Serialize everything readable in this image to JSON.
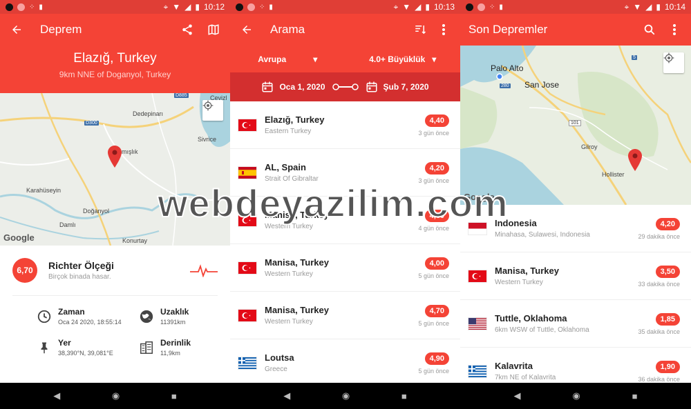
{
  "screen1": {
    "status_time": "10:12",
    "title": "Deprem",
    "location": "Elazığ, Turkey",
    "sublocation": "9km NNE of Doganyol, Turkey",
    "map_labels": [
      "Dedepinarı",
      "Sivrice",
      "mışlık",
      "Karahüseyin",
      "Doğanyol",
      "Damlı",
      "Konurtay",
      "Cevizl"
    ],
    "road_labels": [
      "D885",
      "D300"
    ],
    "google": "Google",
    "magnitude": "6,70",
    "scale_title": "Richter Ölçeği",
    "scale_desc": "Birçok binada hasar.",
    "time_label": "Zaman",
    "time_value": "Oca 24 2020, 18:55:14",
    "distance_label": "Uzaklık",
    "distance_value": "11391km",
    "place_label": "Yer",
    "place_value": "38,390°N, 39,081°E",
    "depth_label": "Derinlik",
    "depth_value": "11,9km"
  },
  "screen2": {
    "status_time": "10:13",
    "title": "Arama",
    "region": "Avrupa",
    "magnitude_filter": "4.0+ Büyüklük",
    "date_from": "Oca 1, 2020",
    "date_to": "Şub 7, 2020",
    "items": [
      {
        "name": "Elazığ, Turkey",
        "region": "Eastern Turkey",
        "mag": "4,40",
        "when": "3 gün önce",
        "flag": "tr"
      },
      {
        "name": "AL, Spain",
        "region": "Strait Of Gibraltar",
        "mag": "4,20",
        "when": "3 gün önce",
        "flag": "es"
      },
      {
        "name": "Manisa, Turkey",
        "region": "Western Turkey",
        "mag": "4,60",
        "when": "4 gün önce",
        "flag": "tr"
      },
      {
        "name": "Manisa, Turkey",
        "region": "Western Turkey",
        "mag": "4,00",
        "when": "5 gün önce",
        "flag": "tr"
      },
      {
        "name": "Manisa, Turkey",
        "region": "Western Turkey",
        "mag": "4,70",
        "when": "5 gün önce",
        "flag": "tr"
      },
      {
        "name": "Loutsa",
        "region": "Greece",
        "mag": "4,90",
        "when": "5 gün önce",
        "flag": "gr"
      }
    ]
  },
  "screen3": {
    "status_time": "10:14",
    "title": "Son Depremler",
    "map_labels": [
      "Palo Alto",
      "San Jose",
      "Gilroy",
      "Hollister"
    ],
    "road_labels": [
      "280",
      "101",
      "5"
    ],
    "google": "Google",
    "items": [
      {
        "name": "Indonesia",
        "region": "Minahasa, Sulawesi, Indonesia",
        "mag": "4,20",
        "when": "29 dakika önce",
        "flag": "id"
      },
      {
        "name": "Manisa, Turkey",
        "region": "Western Turkey",
        "mag": "3,50",
        "when": "33 dakika önce",
        "flag": "tr"
      },
      {
        "name": "Tuttle, Oklahoma",
        "region": "6km WSW of Tuttle, Oklahoma",
        "mag": "1,85",
        "when": "35 dakika önce",
        "flag": "us"
      },
      {
        "name": "Kalavrita",
        "region": "7km NE of Kalavrita",
        "mag": "1,90",
        "when": "36 dakika önce",
        "flag": "gr"
      }
    ]
  },
  "watermark": "webdeyazilim.com",
  "colors": {
    "primary": "#f44336",
    "status": "#e03e36",
    "dark": "#d32f2f"
  }
}
